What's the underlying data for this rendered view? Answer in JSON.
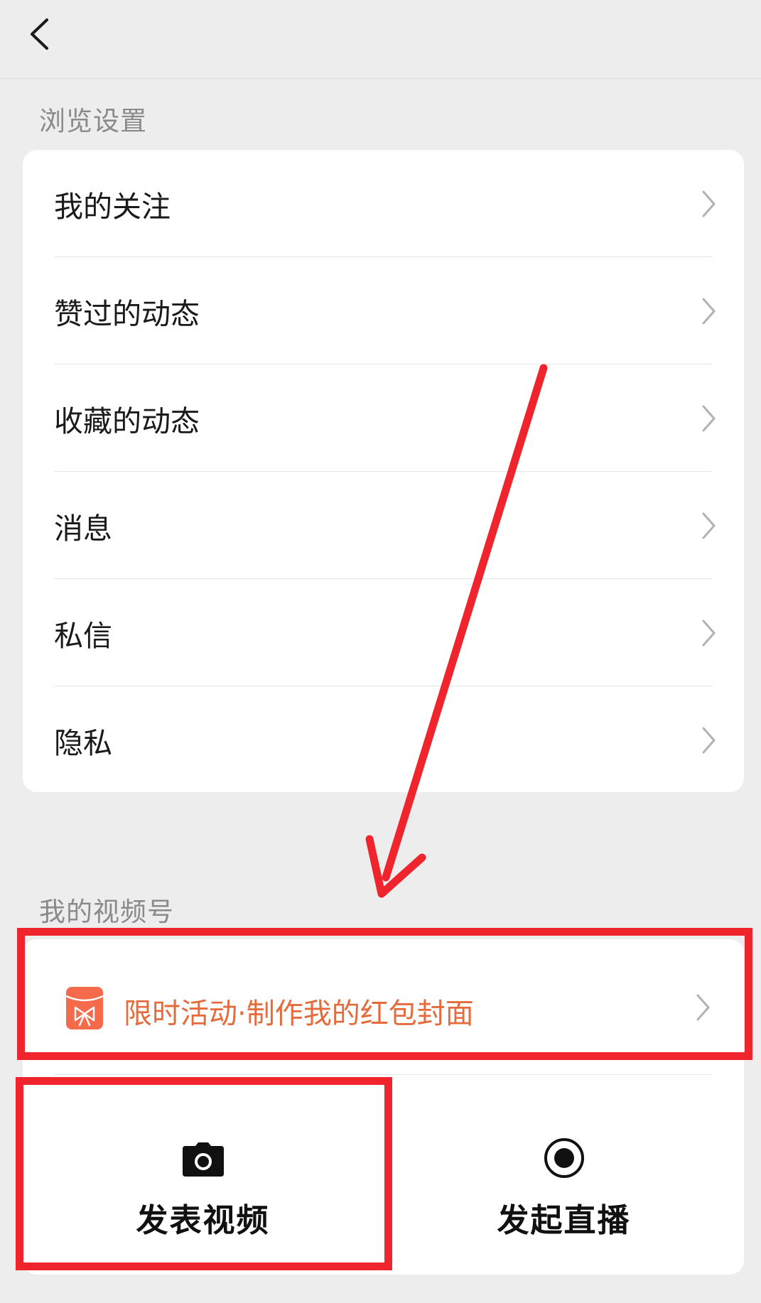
{
  "header": {
    "back_icon": "chevron-left-icon"
  },
  "browse_section": {
    "title": "浏览设置",
    "items": [
      {
        "label": "我的关注"
      },
      {
        "label": "赞过的动态"
      },
      {
        "label": "收藏的动态"
      },
      {
        "label": "消息"
      },
      {
        "label": "私信"
      },
      {
        "label": "隐私"
      }
    ]
  },
  "channel_section": {
    "title": "我的视频号",
    "promo": {
      "icon": "red-envelope-icon",
      "text": "限时活动·制作我的红包封面"
    },
    "actions": [
      {
        "icon": "camera-icon",
        "label": "发表视频"
      },
      {
        "icon": "record-icon",
        "label": "发起直播"
      }
    ]
  },
  "colors": {
    "background": "#ededed",
    "card": "#ffffff",
    "promo_text": "#e56b3c",
    "annotation": "#f0242d"
  }
}
